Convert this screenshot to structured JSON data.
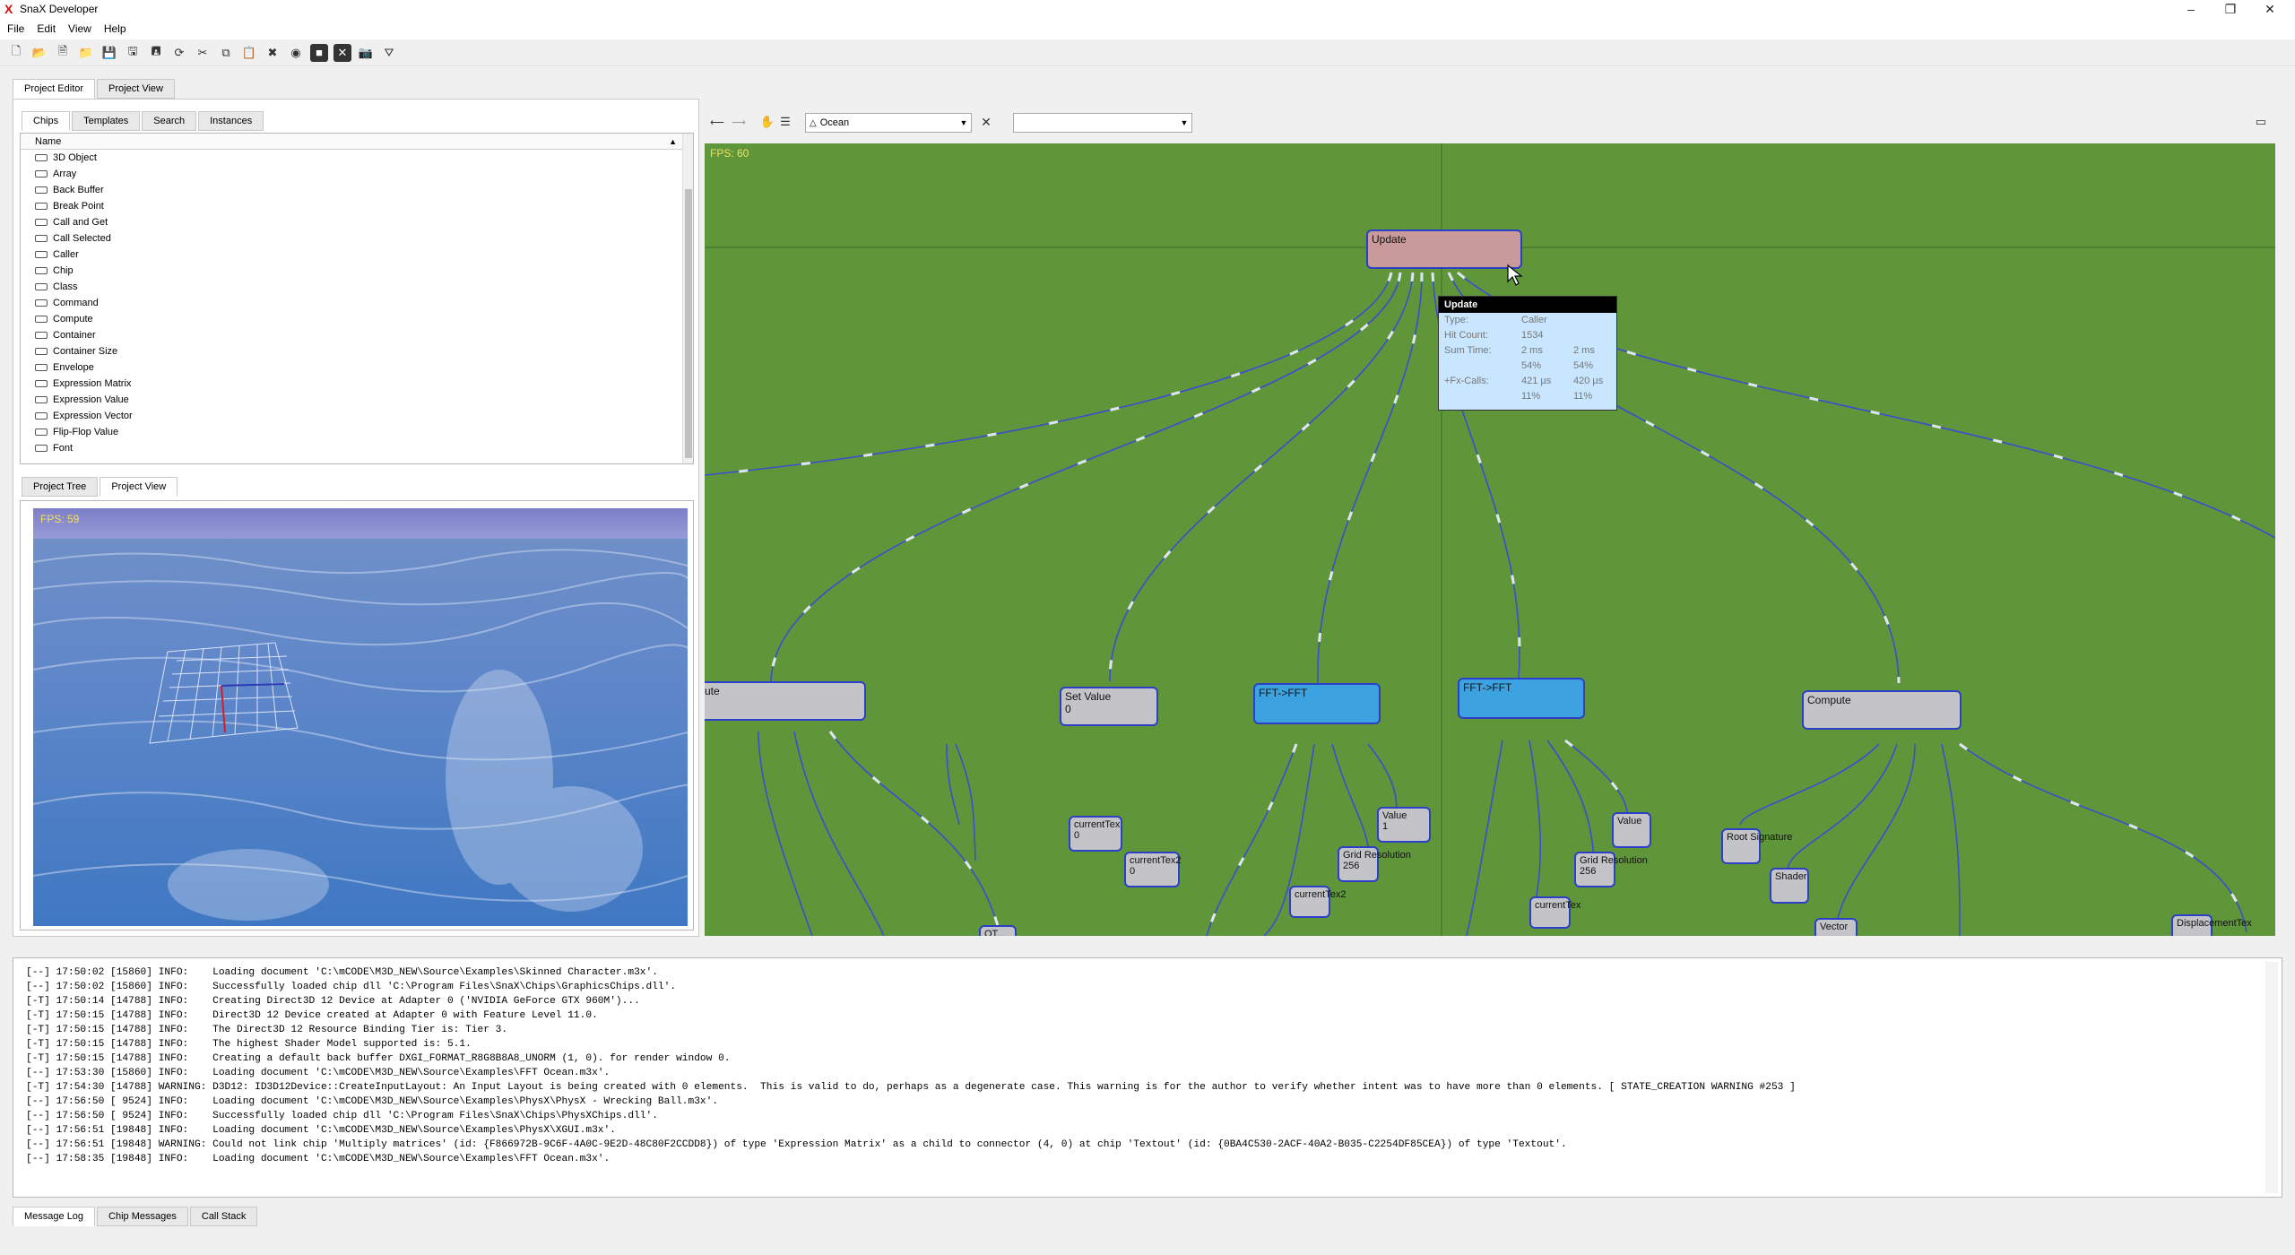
{
  "window": {
    "title": "SnaX Developer",
    "logo": "X"
  },
  "menu": [
    "File",
    "Edit",
    "View",
    "Help"
  ],
  "toolbar_icons": [
    "new-file-icon",
    "open-icon",
    "open-folder-icon",
    "new-doc-icon",
    "open-recent-icon",
    "save-icon",
    "save-all-icon",
    "save-as-icon",
    "save-copy-icon",
    "refresh-icon",
    "cut-icon",
    "copy-icon",
    "paste-icon",
    "delete-icon",
    "run-icon",
    "stop-icon",
    "close-x-icon",
    "screenshot-icon",
    "graph-icon"
  ],
  "editor_tabs": [
    "Project Editor",
    "Project View"
  ],
  "chip_tabs": [
    "Chips",
    "Templates",
    "Search",
    "Instances"
  ],
  "chips_header": "Name",
  "chips": [
    "3D Object",
    "Array",
    "Back Buffer",
    "Break Point",
    "Call and Get",
    "Call Selected",
    "Caller",
    "Chip",
    "Class",
    "Command",
    "Compute",
    "Container",
    "Container Size",
    "Envelope",
    "Expression Matrix",
    "Expression Value",
    "Expression Vector",
    "Flip-Flop Value",
    "Font"
  ],
  "preview_tabs": [
    "Project Tree",
    "Project View"
  ],
  "preview_fps": "FPS: 59",
  "graph": {
    "combo_value": "Ocean",
    "combo2_value": "",
    "fps": "FPS: 60",
    "nodes": {
      "update": "Update",
      "compute_left": "ute",
      "set_value": "Set Value",
      "set_value_sub": "0",
      "fft1": "FFT->FFT",
      "fft2": "FFT->FFT",
      "compute": "Compute",
      "current_tex_a": "currentTex",
      "current_tex_a_sub": "0",
      "current_tex2_a": "currentTex2",
      "current_tex2_a_sub": "0",
      "value_a": "Value",
      "value_a_sub": "1",
      "grid_res_a": "Grid Resolution",
      "grid_res_a_sub": "256",
      "current_tex2_b": "currentTex2",
      "value_b": "Value",
      "grid_res_b": "Grid Resolution",
      "grid_res_b_sub": "256",
      "current_tex_b": "currentTex",
      "root_sig": "Root Signature",
      "shader": "Shader",
      "vector": "Vector",
      "displacement": "DisplacementTex",
      "ot": "OT..."
    }
  },
  "tooltip": {
    "title": "Update",
    "rows": [
      {
        "k": "Type:",
        "v1": "Caller",
        "v2": ""
      },
      {
        "k": "Hit Count:",
        "v1": "1534",
        "v2": ""
      },
      {
        "k": "Sum Time:",
        "v1": "2 ms",
        "v2": "2 ms"
      },
      {
        "k": "",
        "v1": "54%",
        "v2": "54%"
      },
      {
        "k": "+Fx-Calls:",
        "v1": "421 µs",
        "v2": "420 µs"
      },
      {
        "k": "",
        "v1": "11%",
        "v2": "11%"
      }
    ]
  },
  "log": [
    "[--] 17:50:02 [15860] INFO:    Loading document 'C:\\mCODE\\M3D_NEW\\Source\\Examples\\Skinned Character.m3x'.",
    "[--] 17:50:02 [15860] INFO:    Successfully loaded chip dll 'C:\\Program Files\\SnaX\\Chips\\GraphicsChips.dll'.",
    "[-T] 17:50:14 [14788] INFO:    Creating Direct3D 12 Device at Adapter 0 ('NVIDIA GeForce GTX 960M')...",
    "[-T] 17:50:15 [14788] INFO:    Direct3D 12 Device created at Adapter 0 with Feature Level 11.0.",
    "[-T] 17:50:15 [14788] INFO:    The Direct3D 12 Resource Binding Tier is: Tier 3.",
    "[-T] 17:50:15 [14788] INFO:    The highest Shader Model supported is: 5.1.",
    "[-T] 17:50:15 [14788] INFO:    Creating a default back buffer DXGI_FORMAT_R8G8B8A8_UNORM (1, 0). for render window 0.",
    "[--] 17:53:30 [15860] INFO:    Loading document 'C:\\mCODE\\M3D_NEW\\Source\\Examples\\FFT Ocean.m3x'.",
    "[-T] 17:54:30 [14788] WARNING: D3D12: ID3D12Device::CreateInputLayout: An Input Layout is being created with 0 elements.  This is valid to do, perhaps as a degenerate case. This warning is for the author to verify whether intent was to have more than 0 elements. [ STATE_CREATION WARNING #253 ]",
    "[--] 17:56:50 [ 9524] INFO:    Loading document 'C:\\mCODE\\M3D_NEW\\Source\\Examples\\PhysX\\PhysX - Wrecking Ball.m3x'.",
    "[--] 17:56:50 [ 9524] INFO:    Successfully loaded chip dll 'C:\\Program Files\\SnaX\\Chips\\PhysXChips.dll'.",
    "[--] 17:56:51 [19848] INFO:    Loading document 'C:\\mCODE\\M3D_NEW\\Source\\Examples\\PhysX\\XGUI.m3x'.",
    "[--] 17:56:51 [19848] WARNING: Could not link chip 'Multiply matrices' (id: {F866972B-9C6F-4A0C-9E2D-48C80F2CCDD8}) of type 'Expression Matrix' as a child to connector (4, 0) at chip 'Textout' (id: {0BA4C530-2ACF-40A2-B035-C2254DF85CEA}) of type 'Textout'.",
    "[--] 17:58:35 [19848] INFO:    Loading document 'C:\\mCODE\\M3D_NEW\\Source\\Examples\\FFT Ocean.m3x'."
  ],
  "bottom_tabs": [
    "Message Log",
    "Chip Messages",
    "Call Stack"
  ],
  "colors": {
    "graph_bg": "#5f9639",
    "node_border": "#2b3fc7",
    "node_blue": "#3da3e0",
    "node_pink": "#c99a9a",
    "tooltip_bg": "#c8e6ff"
  }
}
